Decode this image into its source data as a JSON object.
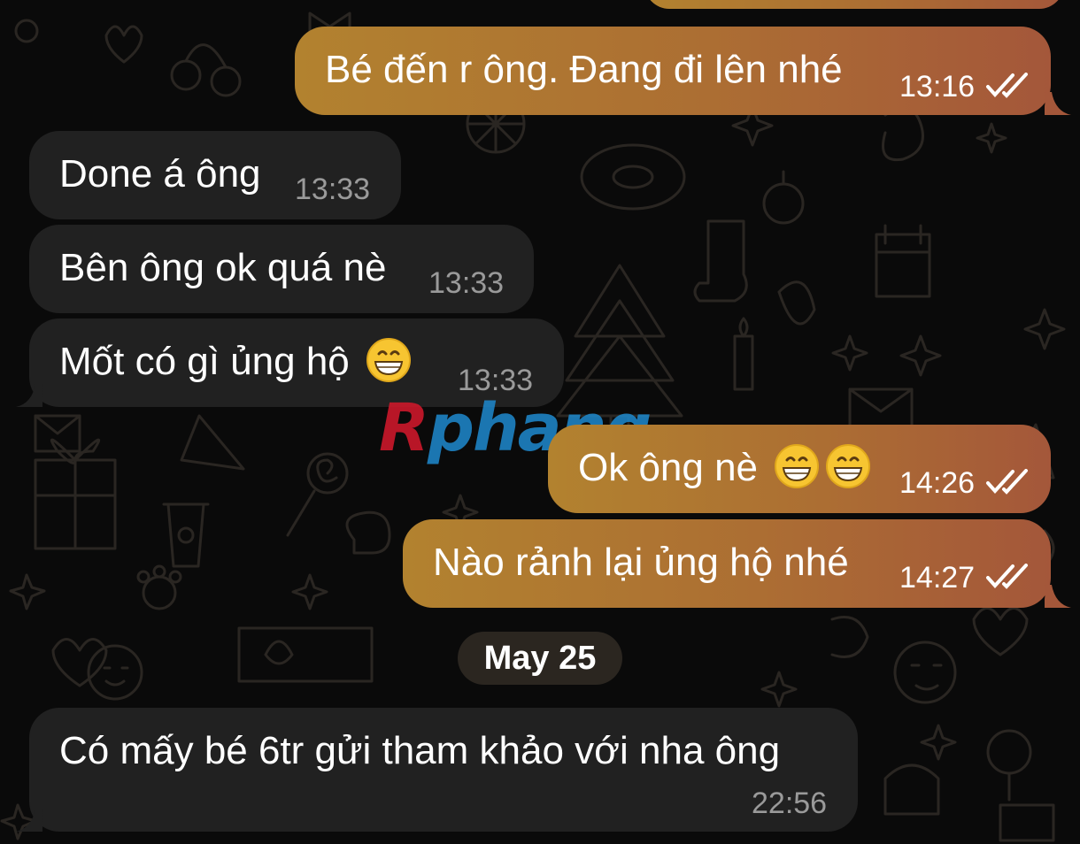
{
  "colors": {
    "background": "#0a0a0a",
    "incoming_bubble": "#212121",
    "outgoing_gradient": [
      "#b2822f",
      "#a4573a"
    ],
    "incoming_time": "#9a9a9a",
    "date_pill": "#2b2620",
    "watermark_red": "#d0182b",
    "watermark_blue": "#1e86c9"
  },
  "messages": [
    {
      "direction": "outgoing",
      "text": "Bé đến r ông. Đang đi lên nhé",
      "time": "13:16",
      "status": "read",
      "status_icon": "double-check-icon"
    },
    {
      "direction": "incoming",
      "text": "Done á ông",
      "time": "13:33"
    },
    {
      "direction": "incoming",
      "text": "Bên ông ok quá nè",
      "time": "13:33"
    },
    {
      "direction": "incoming",
      "text": "Mốt có gì ủng hộ",
      "emoji": "grinning-face-icon",
      "time": "13:33"
    },
    {
      "direction": "outgoing",
      "text": "Ok ông nè",
      "emoji_count": 2,
      "emoji": "grinning-face-icon",
      "time": "14:26",
      "status": "read",
      "status_icon": "double-check-icon"
    },
    {
      "direction": "outgoing",
      "text": "Nào rảnh lại ủng hộ nhé",
      "time": "14:27",
      "status": "read",
      "status_icon": "double-check-icon"
    },
    {
      "direction": "incoming",
      "text": "Có mấy bé 6tr gửi tham khảo với nha ông",
      "time": "22:56"
    }
  ],
  "date_separator": "May 25",
  "watermark": {
    "first_letter": "R",
    "rest": "phang"
  }
}
